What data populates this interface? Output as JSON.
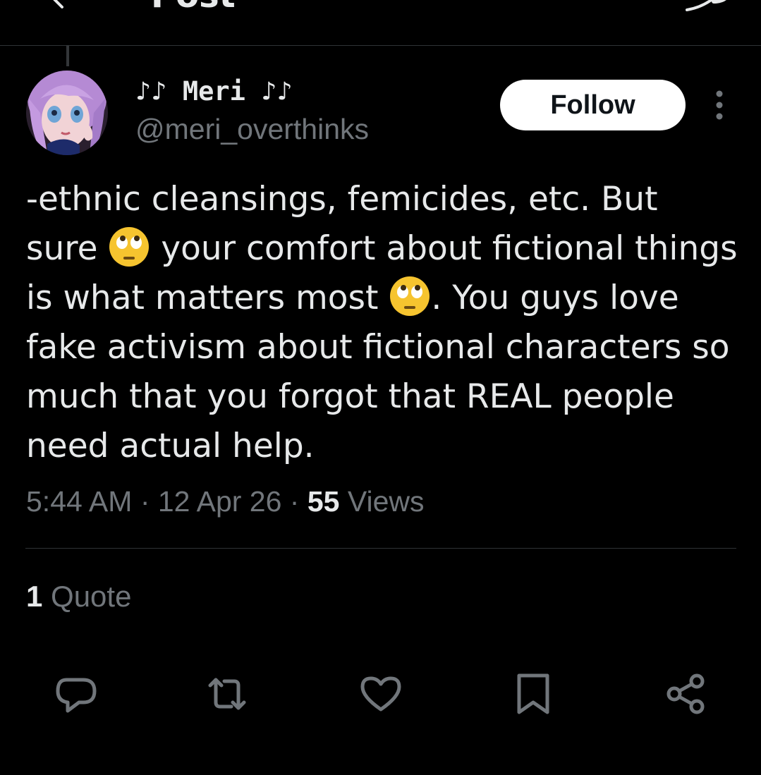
{
  "header": {
    "title": "Post",
    "back_icon": "back-arrow-icon",
    "right_icon": "grok-icon"
  },
  "post": {
    "author": {
      "display_name": "♪♪ Meri ♪♪",
      "handle": "@meri_overthinks",
      "avatar": "anime-girl-purple-hair-avatar"
    },
    "follow_label": "Follow",
    "more_icon": "more-vertical-icon",
    "text_parts": [
      "-ethnic cleansings, femicides, etc. But sure ",
      " your comfort about fictional things is what matters most ",
      ". You guys love fake activism about fictional characters so much that you forgot that REAL people need actual help."
    ],
    "emoji": "face-with-rolling-eyes",
    "time": "5:44 AM",
    "date": "12 Apr 26",
    "views_count": "55",
    "views_label": "Views",
    "quotes_count": "1",
    "quotes_label": "Quote"
  },
  "actions": [
    "reply-icon",
    "repost-icon",
    "like-icon",
    "bookmark-icon",
    "share-icon"
  ],
  "colors": {
    "background": "#000000",
    "text": "#e7e9ea",
    "secondary_text": "#71767b",
    "divider": "#2f3336",
    "follow_bg": "#ffffff",
    "follow_text": "#0f1419"
  }
}
